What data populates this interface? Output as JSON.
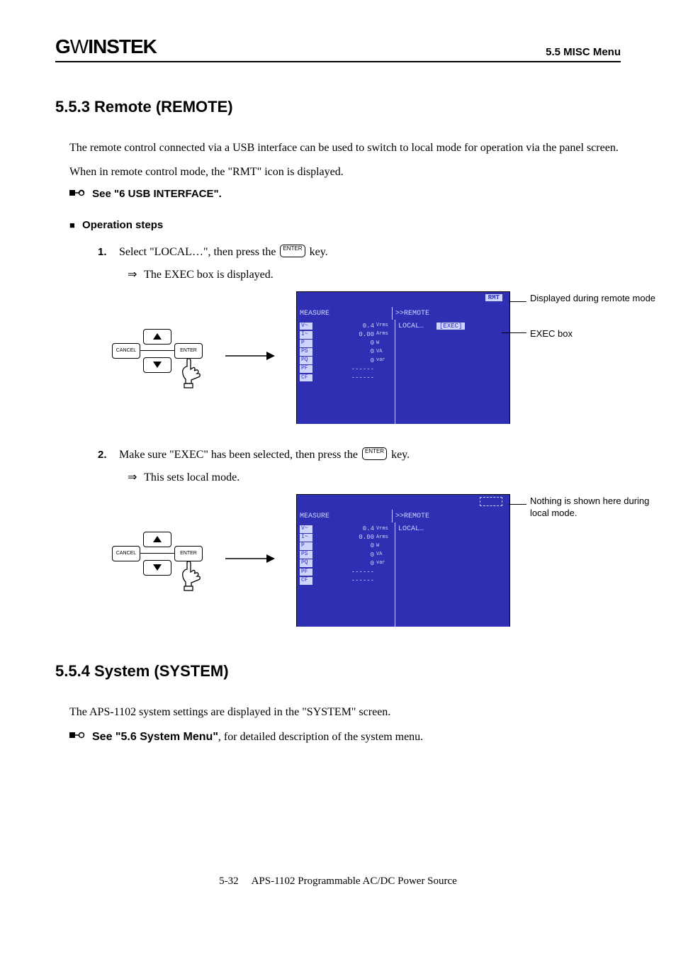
{
  "header": {
    "brand": "GWINSTEK",
    "section_label": "5.5 MISC Menu"
  },
  "sec553": {
    "heading": "5.5.3  Remote (REMOTE)",
    "para1": "The remote control connected via a USB interface can be used to switch to local mode for operation via the panel screen.",
    "para2": "When in remote control mode, the \"RMT\" icon is displayed.",
    "see_label": "See \"6  USB INTERFACE\".",
    "op_steps_label": "Operation steps",
    "step1_num": "1.",
    "step1_a": "Select \"LOCAL…\", then press the ",
    "step1_b": " key.",
    "step1_result": "The EXEC box is displayed.",
    "step2_num": "2.",
    "step2_a": "Make sure \"EXEC\" has been selected, then press the ",
    "step2_b": " key.",
    "step2_result": "This sets local mode.",
    "key_enter": "ENTER",
    "key_cancel": "CANCEL"
  },
  "lcd": {
    "title": "MEASURE",
    "menu": ">>REMOTE",
    "local": "LOCAL…",
    "exec": "[EXEC]",
    "rmt": "RMT",
    "measure_rows": [
      {
        "tag": "V~",
        "val": "0.4",
        "unit": "Vrms"
      },
      {
        "tag": "I~",
        "val": "0.00",
        "unit": "Arms"
      },
      {
        "tag": "P",
        "val": "0",
        "unit": "W"
      },
      {
        "tag": "PS",
        "val": "0",
        "unit": "VA"
      },
      {
        "tag": "PQ",
        "val": "0",
        "unit": "var"
      },
      {
        "tag": "PF",
        "val": "------",
        "unit": ""
      },
      {
        "tag": "CF",
        "val": "------",
        "unit": ""
      }
    ]
  },
  "callouts": {
    "rmt_note": "Displayed during remote mode",
    "exec_note": "EXEC box",
    "local_note": "Nothing is shown here during local mode."
  },
  "sec554": {
    "heading": "5.5.4  System (SYSTEM)",
    "para1": "The APS-1102 system settings are displayed in the \"SYSTEM\" screen.",
    "see_bold": "See \"5.6  System Menu\"",
    "see_rest": ", for detailed description of the system menu."
  },
  "footer": {
    "page": "5-32",
    "doc": "APS-1102 Programmable AC/DC Power Source"
  },
  "aux": {
    "result_arrow": "⇒"
  }
}
